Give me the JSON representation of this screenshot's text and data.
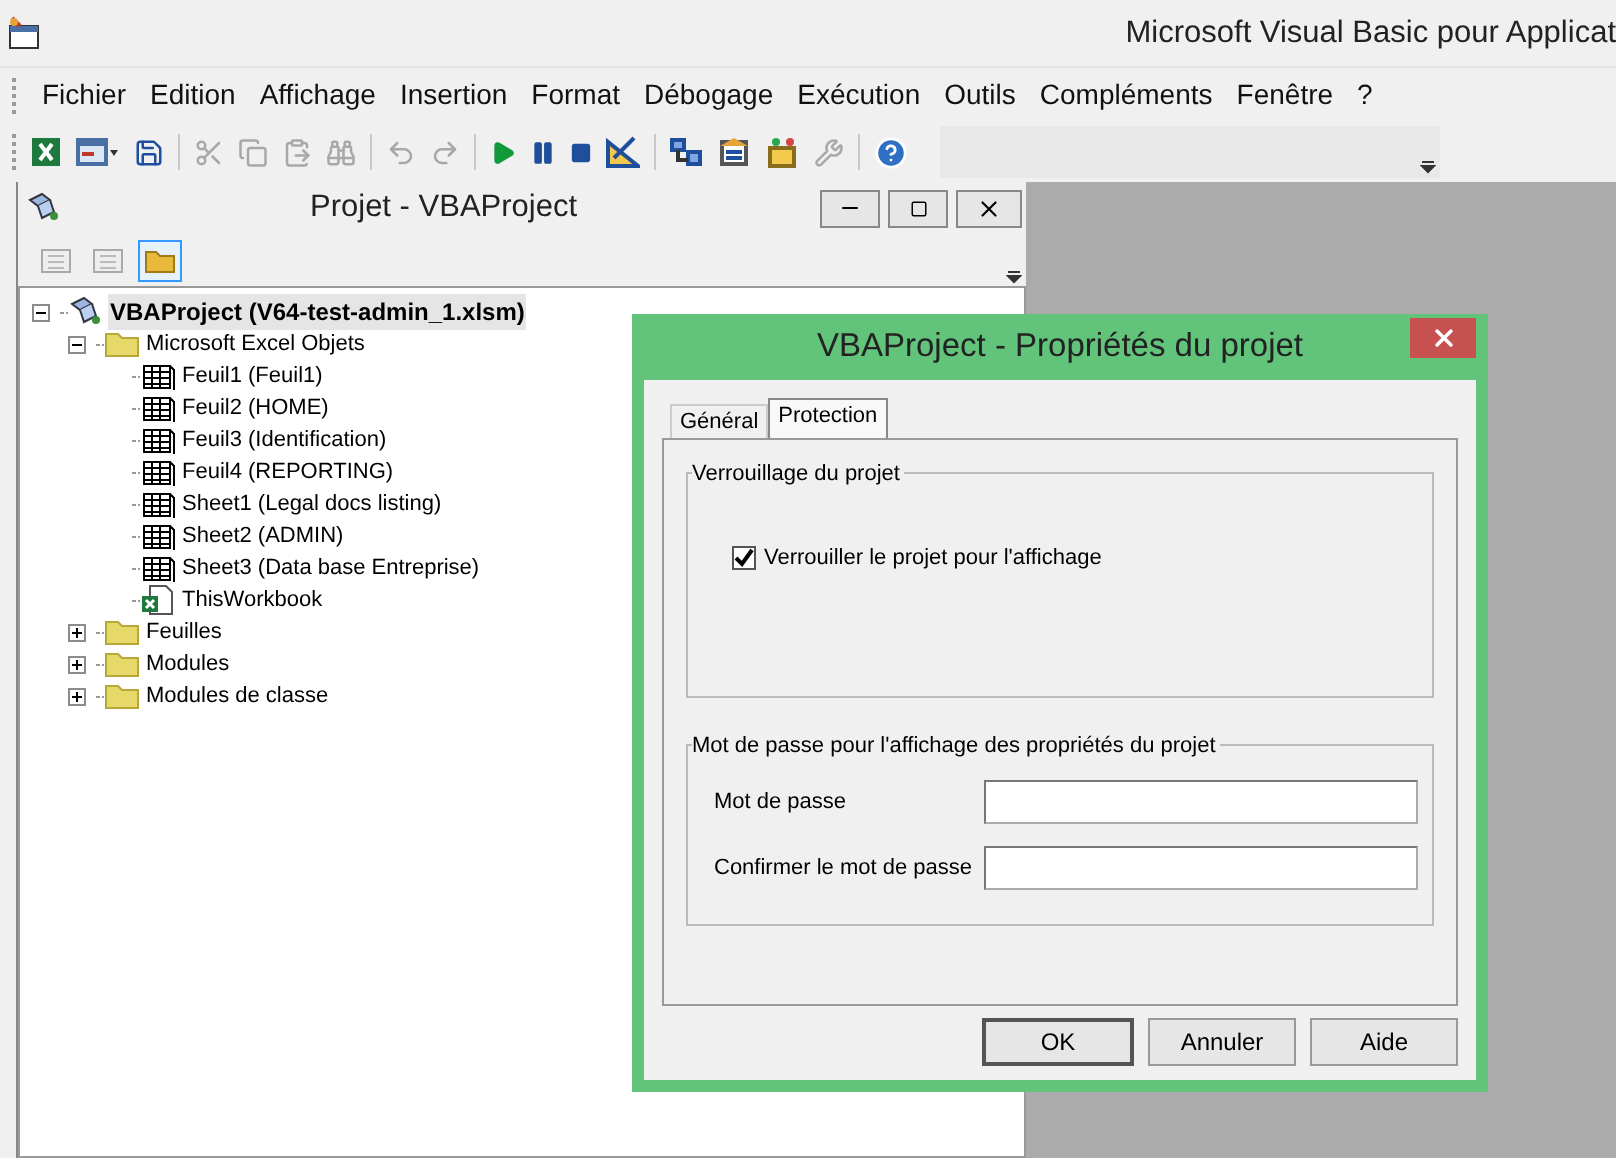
{
  "app": {
    "title": "Microsoft Visual Basic pour Applicat"
  },
  "menu": [
    {
      "label": "Fichier"
    },
    {
      "label": "Edition"
    },
    {
      "label": "Affichage"
    },
    {
      "label": "Insertion"
    },
    {
      "label": "Format"
    },
    {
      "label": "Débogage"
    },
    {
      "label": "Exécution"
    },
    {
      "label": "Outils"
    },
    {
      "label": "Compléments"
    },
    {
      "label": "Fenêtre"
    },
    {
      "label": "?"
    }
  ],
  "toolbar": [
    {
      "kind": "excel",
      "disabled": false
    },
    {
      "kind": "userform",
      "disabled": false
    },
    {
      "kind": "save",
      "disabled": false
    },
    {
      "kind": "separator"
    },
    {
      "kind": "cut",
      "disabled": true
    },
    {
      "kind": "copy",
      "disabled": true
    },
    {
      "kind": "paste",
      "disabled": true
    },
    {
      "kind": "find",
      "disabled": true
    },
    {
      "kind": "separator"
    },
    {
      "kind": "undo",
      "disabled": true
    },
    {
      "kind": "redo",
      "disabled": true
    },
    {
      "kind": "separator"
    },
    {
      "kind": "run",
      "disabled": false
    },
    {
      "kind": "pause",
      "disabled": false
    },
    {
      "kind": "stop",
      "disabled": false
    },
    {
      "kind": "design",
      "disabled": false
    },
    {
      "kind": "separator"
    },
    {
      "kind": "project",
      "disabled": false
    },
    {
      "kind": "properties",
      "disabled": false
    },
    {
      "kind": "objects",
      "disabled": false
    },
    {
      "kind": "toolbox",
      "disabled": true
    },
    {
      "kind": "separator"
    },
    {
      "kind": "help",
      "disabled": false
    }
  ],
  "project_window": {
    "title": "Projet - VBAProject",
    "toolbar": [
      {
        "kind": "view-code",
        "selected": false
      },
      {
        "kind": "view-object",
        "selected": false
      },
      {
        "kind": "toggle-folders",
        "selected": true
      }
    ],
    "tree": [
      {
        "kind": "project",
        "label": "VBAProject (V64-test-admin_1.xlsm)",
        "selected": true,
        "expanded": true,
        "children": [
          {
            "kind": "folder",
            "label": "Microsoft Excel Objets",
            "selected": false,
            "expanded": true,
            "children": [
              {
                "kind": "sheet",
                "label": "Feuil1 (Feuil1)",
                "selected": false
              },
              {
                "kind": "sheet",
                "label": "Feuil2 (HOME)",
                "selected": false
              },
              {
                "kind": "sheet",
                "label": "Feuil3 (Identification)",
                "selected": false
              },
              {
                "kind": "sheet",
                "label": "Feuil4 (REPORTING)",
                "selected": false
              },
              {
                "kind": "sheet",
                "label": "Sheet1 (Legal docs listing)",
                "selected": false
              },
              {
                "kind": "sheet",
                "label": "Sheet2 (ADMIN)",
                "selected": false
              },
              {
                "kind": "sheet",
                "label": "Sheet3 (Data base Entreprise)",
                "selected": false
              },
              {
                "kind": "workbook",
                "label": "ThisWorkbook",
                "selected": false
              }
            ]
          },
          {
            "kind": "folder",
            "label": "Feuilles",
            "selected": false,
            "expanded": false
          },
          {
            "kind": "folder",
            "label": "Modules",
            "selected": false,
            "expanded": false
          },
          {
            "kind": "folder",
            "label": "Modules de classe",
            "selected": false,
            "expanded": false
          }
        ]
      }
    ]
  },
  "dialog": {
    "title": "VBAProject - Propriétés du projet",
    "tabs": [
      {
        "label": "Général",
        "selected": false
      },
      {
        "label": "Protection",
        "selected": true
      }
    ],
    "lock_group": {
      "title": "Verrouillage du projet",
      "checkbox": {
        "label": "Verrouiller le projet pour l'affichage",
        "checked": true
      }
    },
    "password_group": {
      "title": "Mot de passe pour l'affichage des propriétés du projet",
      "fields": [
        {
          "label": "Mot de passe"
        },
        {
          "label": "Confirmer le mot de passe"
        }
      ]
    },
    "buttons": [
      {
        "label": "OK",
        "default": true
      },
      {
        "label": "Annuler",
        "default": false
      },
      {
        "label": "Aide",
        "default": false
      }
    ]
  }
}
